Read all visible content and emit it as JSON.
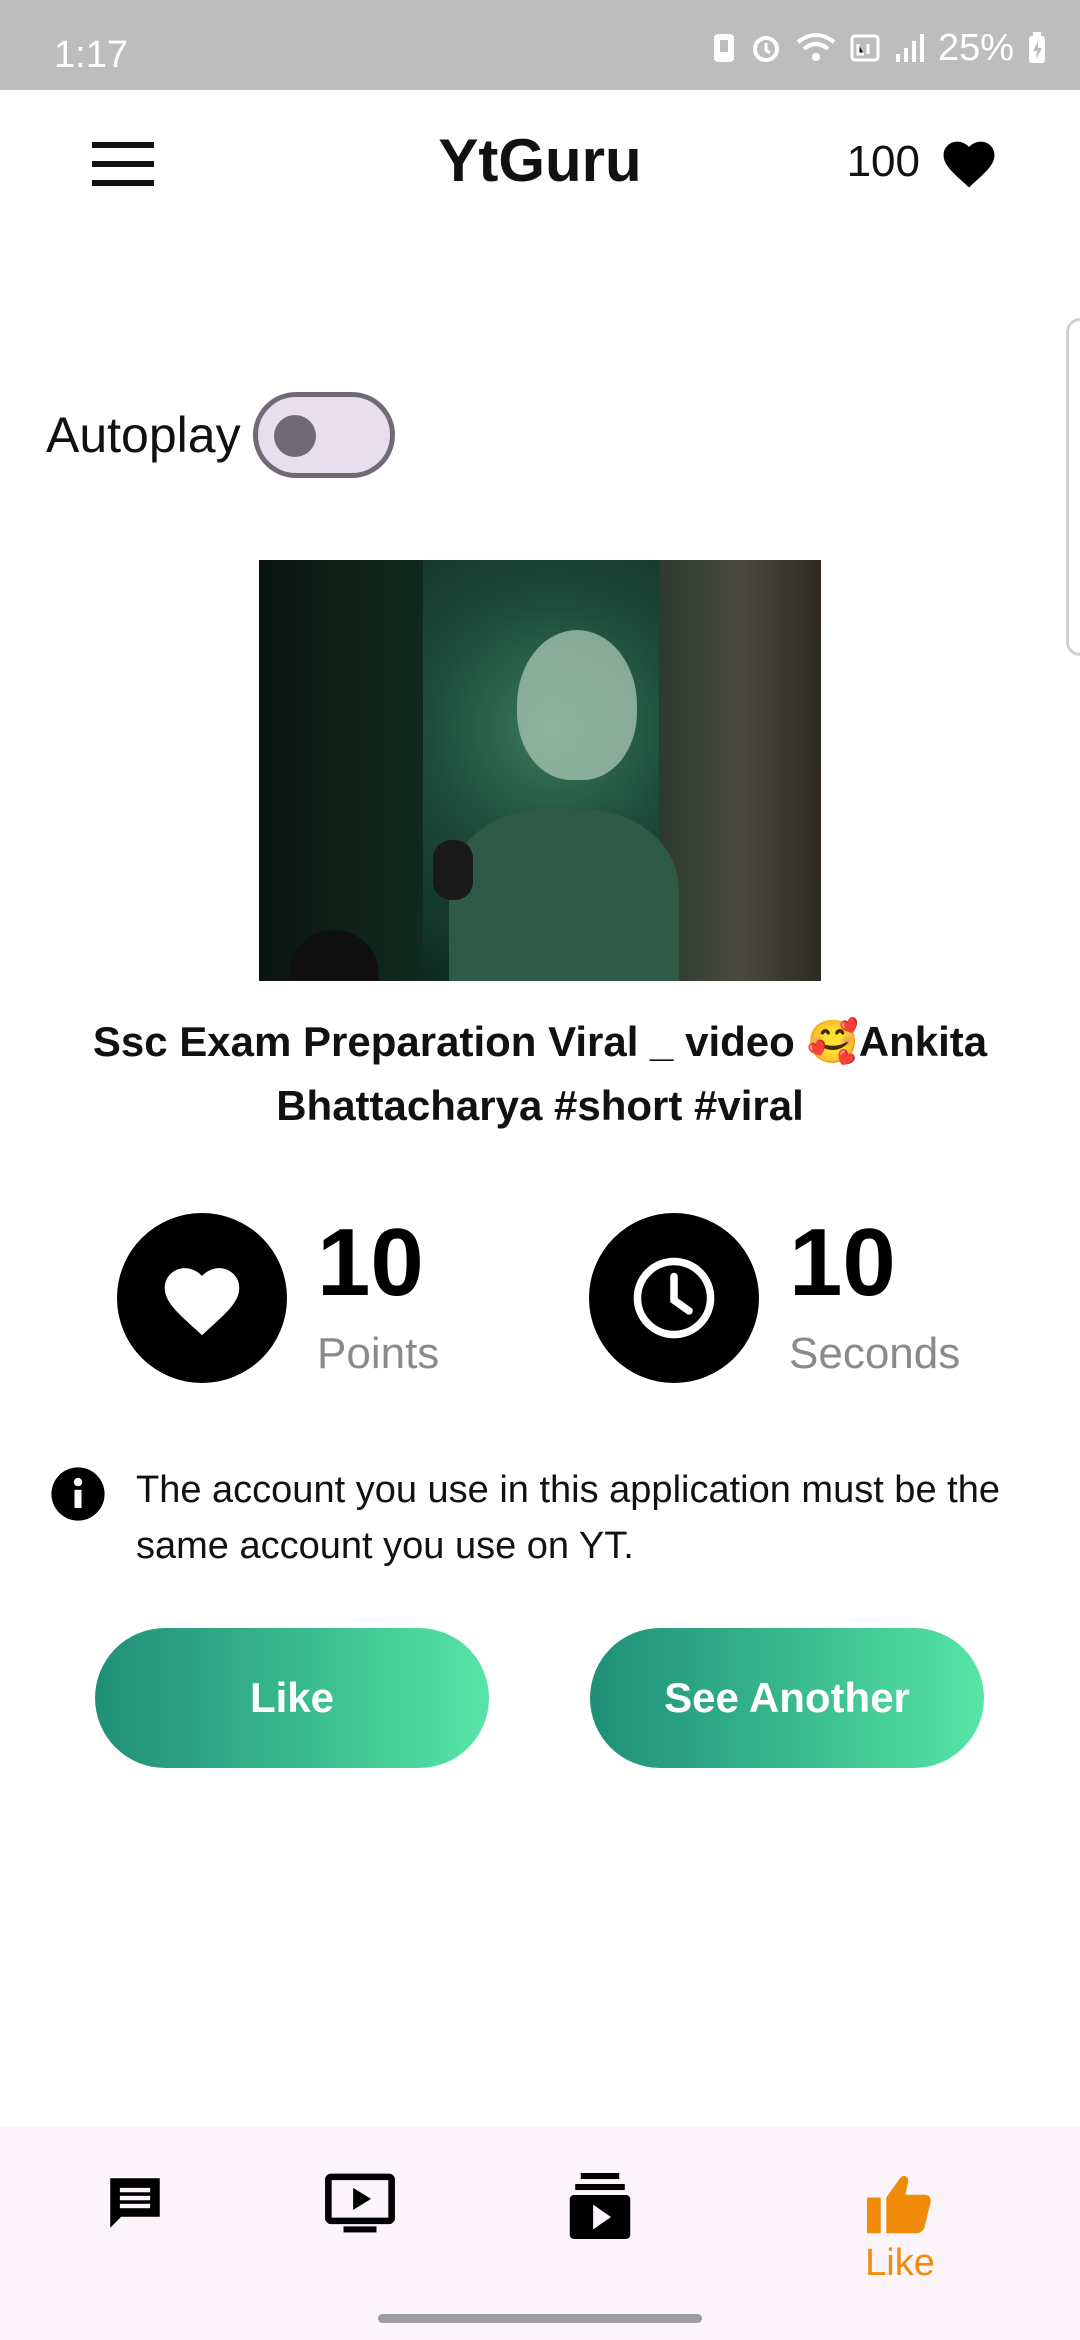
{
  "status_bar": {
    "time": "1:17",
    "battery": "25%"
  },
  "app_bar": {
    "title": "YtGuru",
    "points": "100"
  },
  "autoplay": {
    "label": "Autoplay",
    "enabled": false
  },
  "video": {
    "title": "Ssc Exam Preparation Viral _ video 🥰Ankita Bhattacharya #short #viral"
  },
  "stats": {
    "points": {
      "value": "10",
      "label": "Points"
    },
    "seconds": {
      "value": "10",
      "label": "Seconds"
    }
  },
  "info": {
    "text": "The account you use in this application must be the same account you use on YT."
  },
  "buttons": {
    "like": "Like",
    "see_another": "See Another"
  },
  "bottom_nav": {
    "items": [
      {
        "icon": "message-icon",
        "label": ""
      },
      {
        "icon": "tv-play-icon",
        "label": ""
      },
      {
        "icon": "subscriptions-icon",
        "label": ""
      },
      {
        "icon": "thumb-up-icon",
        "label": "Like",
        "active": true
      }
    ],
    "active_color": "#f08c0a"
  },
  "colors": {
    "button_gradient_start": "#1f8f78",
    "button_gradient_end": "#56e6a6",
    "status_bar": "#bdbdbd"
  }
}
